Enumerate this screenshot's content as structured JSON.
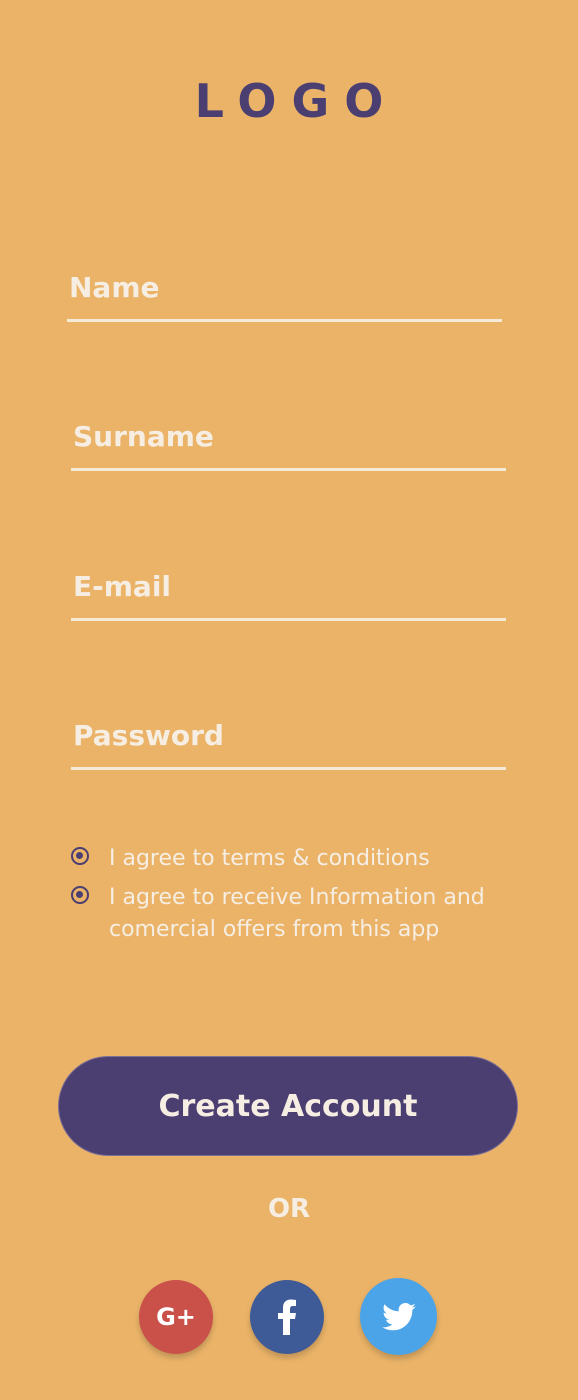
{
  "logo": {
    "text": "LOGO"
  },
  "form": {
    "name_label": "Name",
    "surname_label": "Surname",
    "email_label": "E-mail",
    "password_label": "Password"
  },
  "agreements": {
    "terms": "I agree to terms & conditions",
    "offers": "I agree to receive Information and comercial offers from this app"
  },
  "actions": {
    "create_account": "Create Account",
    "or_label": "OR"
  },
  "social": {
    "google_label": "G+",
    "google_icon": "google-plus-icon",
    "facebook_icon": "facebook-icon",
    "twitter_icon": "twitter-icon"
  },
  "colors": {
    "background": "#EAB368",
    "primary": "#4B3F72",
    "text_light": "#F6EEE3",
    "google": "#C9514A",
    "facebook": "#3F5B97",
    "twitter": "#4BA3E8"
  }
}
